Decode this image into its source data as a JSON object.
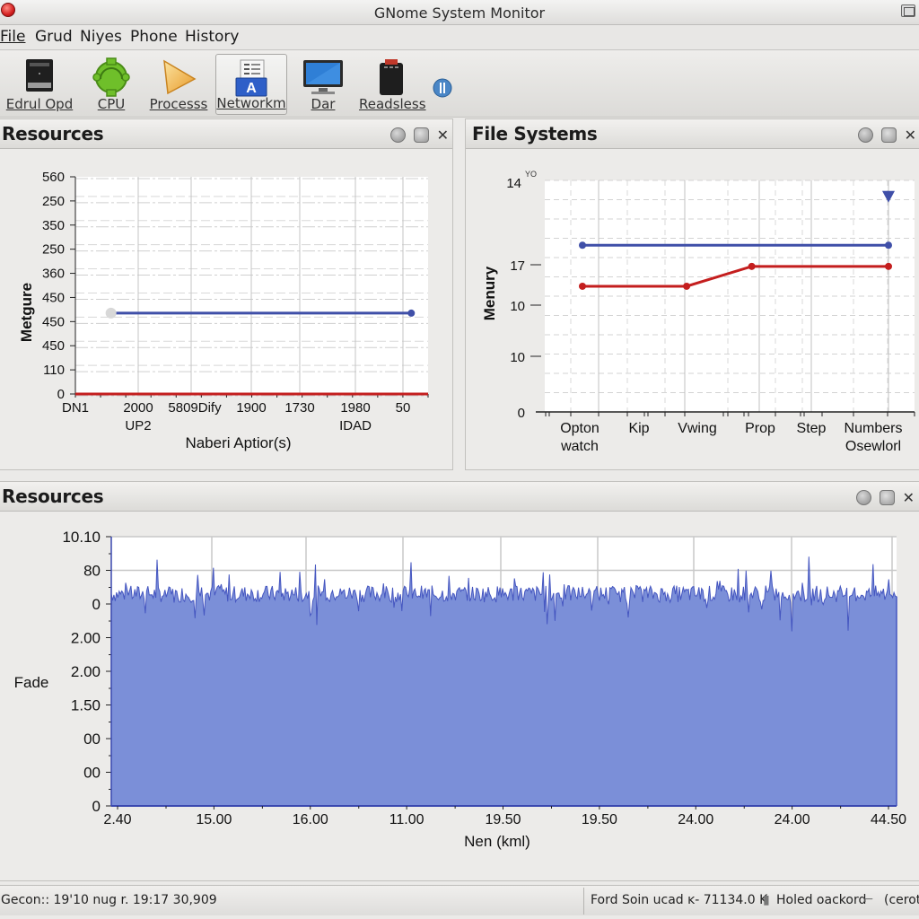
{
  "window": {
    "title": "GNome System Monitor"
  },
  "menubar": {
    "items": [
      {
        "label": "File",
        "mnemonic": "F"
      },
      {
        "label": "Grud",
        "mnemonic": ""
      },
      {
        "label": "Niyes",
        "mnemonic": ""
      },
      {
        "label": "Phone",
        "mnemonic": "P"
      },
      {
        "label": "History",
        "mnemonic": ""
      }
    ]
  },
  "toolbar": {
    "items": [
      {
        "label": "Edrul Opd",
        "icon": "drive-icon",
        "active": false
      },
      {
        "label": "CPU",
        "icon": "cpu-chip-icon",
        "active": false
      },
      {
        "label": "Processs",
        "icon": "play-triangle-icon",
        "active": false
      },
      {
        "label": "Networkm",
        "icon": "network-document-icon",
        "active": true
      },
      {
        "label": "Dar",
        "icon": "monitor-icon",
        "active": false
      },
      {
        "label": "Readsless",
        "icon": "device-icon",
        "active": false
      }
    ],
    "extra_icon": "info-icon"
  },
  "panels": {
    "resources_top": {
      "title": "Resources",
      "header_icons": [
        "globe-icon",
        "restore-icon",
        "close-icon"
      ]
    },
    "file_systems": {
      "title": "File Systems",
      "header_icons": [
        "globe-icon",
        "restore-icon",
        "close-icon"
      ]
    },
    "resources_bottom": {
      "title": "Resources",
      "header_icons": [
        "globe-icon",
        "restore-icon",
        "close-icon"
      ]
    }
  },
  "chart_data": [
    {
      "id": "resources-top-chart",
      "type": "line",
      "title": "",
      "ylabel": "Metgure",
      "xlabel": "Naberi Aptior(s)",
      "y_tick_labels": [
        "560",
        "250",
        "350",
        "250",
        "360",
        "450",
        "450",
        "450",
        "110",
        "0"
      ],
      "x_tick_labels": [
        "DN1",
        "2000\nUP2",
        "5809Dify",
        "1900",
        "1730",
        "1980\nIDAD",
        "50"
      ],
      "ylim": [
        0,
        9
      ],
      "grid": true,
      "series": [
        {
          "name": "blue",
          "color": "#3f4fa8",
          "x": [
            0.7,
            6.0
          ],
          "y": [
            3.35,
            3.35
          ]
        },
        {
          "name": "red",
          "color": "#c41e1e",
          "x": [
            0,
            6.3
          ],
          "y": [
            0,
            0
          ]
        }
      ]
    },
    {
      "id": "file-systems-chart",
      "type": "line",
      "title": "",
      "ylabel": "Menury",
      "xlabel": "",
      "y_tick_labels": [
        "14",
        "17",
        "10",
        "10",
        "0"
      ],
      "y_tick_superscript": "YO",
      "x_tick_labels": [
        "Opton\nwatch",
        "Kip",
        "Vwing",
        "Prop",
        "Step",
        "Numbers\nOsewlorl"
      ],
      "ylim": [
        0,
        17.5
      ],
      "grid": true,
      "series": [
        {
          "name": "blue",
          "color": "#3f4fa8",
          "x": [
            0,
            4.7
          ],
          "y": [
            12.6,
            12.6
          ]
        },
        {
          "name": "red",
          "color": "#c41e1e",
          "x": [
            0,
            1.6,
            2.6,
            4.7
          ],
          "y": [
            9.5,
            9.5,
            11.0,
            11.0
          ]
        }
      ],
      "marker": {
        "type": "triangle-down",
        "x": 4.7,
        "y": 16.3,
        "color": "#3f4fa8"
      }
    },
    {
      "id": "resources-bottom-chart",
      "type": "area",
      "title": "",
      "ylabel": "Fade",
      "xlabel": "Nen (kml)",
      "y_tick_labels": [
        "10.10",
        "80",
        "0",
        "2.00",
        "2.00",
        "1.50",
        "00",
        "00",
        "0"
      ],
      "x_tick_labels": [
        "2.40",
        "15.00",
        "16.00",
        "11.00",
        "19.50",
        "19.50",
        "24.00",
        "24.00",
        "44.50"
      ],
      "ylim": [
        0,
        8
      ],
      "fill_color": "#7b8fd8",
      "line_color": "#4556c0",
      "baseline_level": 6.3,
      "noise_amplitude": 0.5,
      "samples": 600,
      "grid": true
    }
  ],
  "statusbar": {
    "left": "Gecon:: 19'10 nug r. 19:17 30,909",
    "right_1": "Ford Soin ucad ĸ- 71134.0 K",
    "right_2": "Holed oackord",
    "right_3": "(cerot"
  }
}
